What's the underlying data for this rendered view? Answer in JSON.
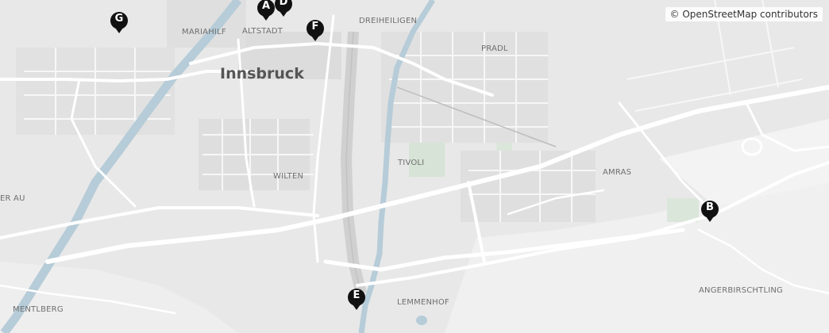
{
  "map": {
    "city_label": "Innsbruck",
    "attribution": "© OpenStreetMap contributors",
    "district_labels": {
      "mariahilf": "MARIAHILF",
      "altstadt": "ALTSTADT",
      "dreiheiligen": "DREIHEILIGEN",
      "pradl": "PRADL",
      "wilten": "WILTEN",
      "tivoli": "TIVOLI",
      "amras": "AMRAS",
      "hoetting_au": "ER AU",
      "mentlberg": "MENTLBERG",
      "lemmenhof": "LEMMENHOF",
      "angerbirschtling": "ANGERBIRSCHTLING"
    },
    "markers": {
      "a": "A",
      "b": "B",
      "d": "D",
      "e": "E",
      "f": "F",
      "g": "G"
    }
  }
}
